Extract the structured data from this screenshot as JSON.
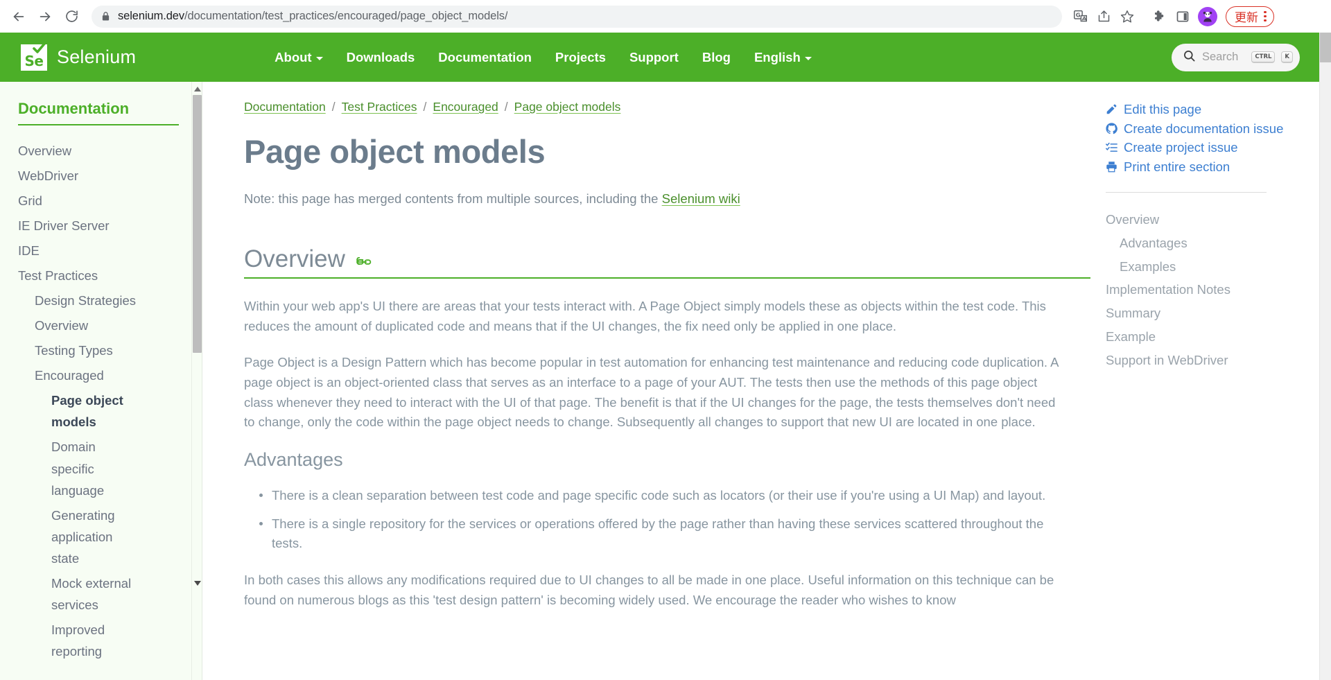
{
  "browser": {
    "back_icon": "back-arrow-icon",
    "forward_icon": "forward-arrow-icon",
    "reload_icon": "reload-icon",
    "lock_icon": "lock-icon",
    "url_host": "selenium.dev",
    "url_path": "/documentation/test_practices/encouraged/page_object_models/",
    "toolbar_icons": [
      "translate-icon",
      "share-icon",
      "bookmark-star-icon",
      "extensions-puzzle-icon",
      "side-panel-icon",
      "profile-avatar-icon"
    ],
    "update_label": "更新",
    "menu_icon": "kebab-menu-icon"
  },
  "header": {
    "logo_text": "Se",
    "brand": "Selenium",
    "nav": [
      {
        "label": "About",
        "has_caret": true
      },
      {
        "label": "Downloads",
        "has_caret": false
      },
      {
        "label": "Documentation",
        "has_caret": false
      },
      {
        "label": "Projects",
        "has_caret": false
      },
      {
        "label": "Support",
        "has_caret": false
      },
      {
        "label": "Blog",
        "has_caret": false
      },
      {
        "label": "English",
        "has_caret": true
      }
    ],
    "search": {
      "icon": "search-icon",
      "placeholder": "Search",
      "kbd1": "CTRL",
      "kbd2": "K"
    }
  },
  "sidebar": {
    "title": "Documentation",
    "items": [
      {
        "label": "Overview",
        "level": 0,
        "active": false
      },
      {
        "label": "WebDriver",
        "level": 0,
        "active": false
      },
      {
        "label": "Grid",
        "level": 0,
        "active": false
      },
      {
        "label": "IE Driver Server",
        "level": 0,
        "active": false
      },
      {
        "label": "IDE",
        "level": 0,
        "active": false
      },
      {
        "label": "Test Practices",
        "level": 0,
        "active": false
      },
      {
        "label": "Design Strategies",
        "level": 1,
        "active": false
      },
      {
        "label": "Overview",
        "level": 1,
        "active": false
      },
      {
        "label": "Testing Types",
        "level": 1,
        "active": false
      },
      {
        "label": "Encouraged",
        "level": 1,
        "active": false
      },
      {
        "label": "Page object models",
        "level": 2,
        "active": true
      },
      {
        "label": "Domain specific language",
        "level": 2,
        "active": false
      },
      {
        "label": "Generating application state",
        "level": 2,
        "active": false
      },
      {
        "label": "Mock external services",
        "level": 2,
        "active": false
      },
      {
        "label": "Improved reporting",
        "level": 2,
        "active": false
      }
    ]
  },
  "breadcrumb": [
    "Documentation",
    "Test Practices",
    "Encouraged",
    "Page object models"
  ],
  "breadcrumb_sep": "/",
  "main": {
    "title": "Page object models",
    "note_prefix": "Note: this page has merged contents from multiple sources, including the ",
    "note_link": "Selenium wiki",
    "h2_overview": "Overview",
    "anchor_icon": "link-anchor-icon",
    "p1": "Within your web app's UI there are areas that your tests interact with. A Page Object simply models these as objects within the test code. This reduces the amount of duplicated code and means that if the UI changes, the fix need only be applied in one place.",
    "p2": "Page Object is a Design Pattern which has become popular in test automation for enhancing test maintenance and reducing code duplication. A page object is an object-oriented class that serves as an interface to a page of your AUT. The tests then use the methods of this page object class whenever they need to interact with the UI of that page. The benefit is that if the UI changes for the page, the tests themselves don't need to change, only the code within the page object needs to change. Subsequently all changes to support that new UI are located in one place.",
    "h3_advantages": "Advantages",
    "bullets": [
      "There is a clean separation between test code and page specific code such as locators (or their use if you're using a UI Map) and layout.",
      "There is a single repository for the services or operations offered by the page rather than having these services scattered throughout the tests."
    ],
    "p3": "In both cases this allows any modifications required due to UI changes to all be made in one place. Useful information on this technique can be found on numerous blogs as this 'test design pattern' is becoming widely used. We encourage the reader who wishes to know"
  },
  "right_sidebar": {
    "actions": [
      {
        "label": "Edit this page",
        "icon": "edit-pencil-icon"
      },
      {
        "label": "Create documentation issue",
        "icon": "github-icon"
      },
      {
        "label": "Create project issue",
        "icon": "task-list-icon"
      },
      {
        "label": "Print entire section",
        "icon": "printer-icon"
      }
    ],
    "toc": [
      {
        "label": "Overview",
        "sub": false
      },
      {
        "label": "Advantages",
        "sub": true
      },
      {
        "label": "Examples",
        "sub": true
      },
      {
        "label": "Implementation Notes",
        "sub": false
      },
      {
        "label": "Summary",
        "sub": false
      },
      {
        "label": "Example",
        "sub": false
      },
      {
        "label": "Support in WebDriver",
        "sub": false
      }
    ]
  },
  "colors": {
    "brand_green": "#4caf28",
    "link_blue": "#3d7fd1",
    "body_gray": "#8795a0",
    "update_red": "#d93025"
  }
}
